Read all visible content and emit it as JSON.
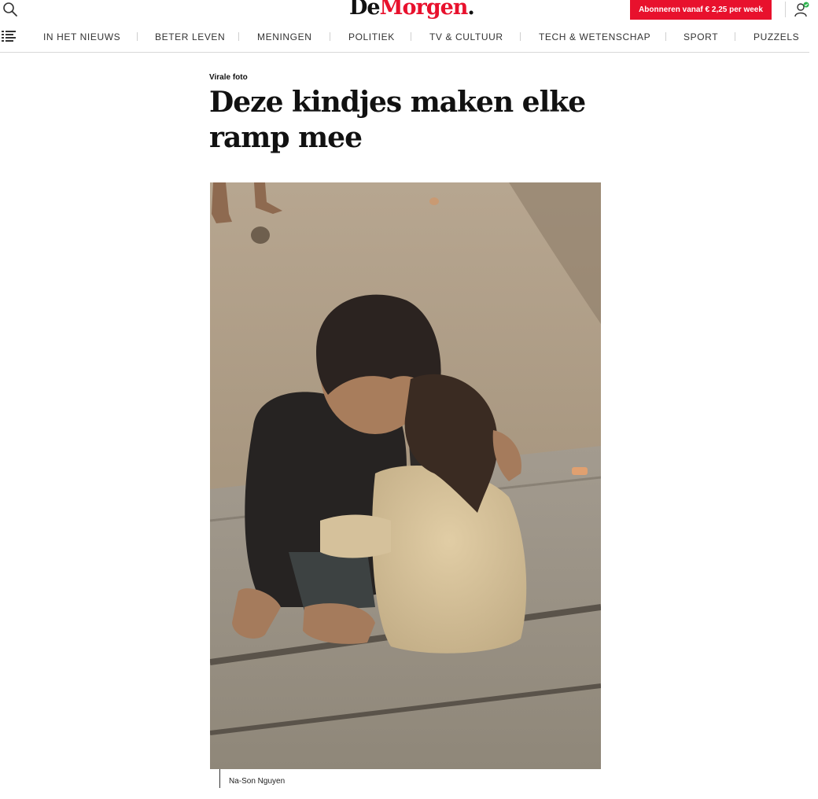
{
  "header": {
    "logo_de": "De",
    "logo_morgen": "Morgen",
    "logo_dot": ".",
    "subscribe_label": "Abonneren vanaf € 2,25 per week",
    "icons": [
      "search-icon",
      "account-icon"
    ],
    "colors": {
      "brand_red": "#e8112d",
      "text": "#111111",
      "divider": "#d8d8d8"
    }
  },
  "nav": {
    "menu_icon": "list-menu-icon",
    "items": [
      {
        "label": "IN HET NIEUWS"
      },
      {
        "label": "BETER LEVEN"
      },
      {
        "label": "MENINGEN"
      },
      {
        "label": "POLITIEK"
      },
      {
        "label": "TV & CULTUUR"
      },
      {
        "label": "TECH & WETENSCHAP"
      },
      {
        "label": "SPORT"
      },
      {
        "label": "PUZZELS"
      }
    ]
  },
  "article": {
    "kicker": "Virale foto",
    "headline": "Deze kindjes maken elke ramp mee",
    "photo_credit": "Na-Son Nguyen"
  }
}
